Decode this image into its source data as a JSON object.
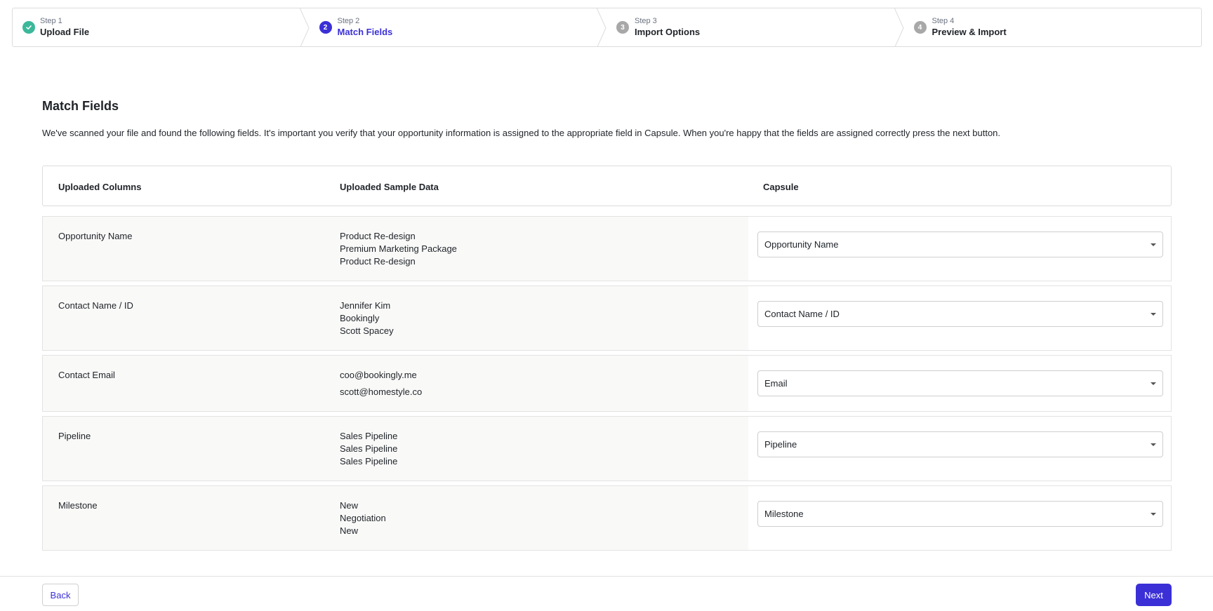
{
  "colors": {
    "accent": "#3b30d6",
    "complete": "#3bb89a",
    "pending": "#a8a8a8"
  },
  "steps": [
    {
      "number": "Step 1",
      "title": "Upload File",
      "badge": "check-icon",
      "state": "complete"
    },
    {
      "number": "Step 2",
      "title": "Match Fields",
      "badge": "2",
      "state": "current"
    },
    {
      "number": "Step 3",
      "title": "Import Options",
      "badge": "3",
      "state": "pending"
    },
    {
      "number": "Step 4",
      "title": "Preview & Import",
      "badge": "4",
      "state": "pending"
    }
  ],
  "page": {
    "title": "Match Fields",
    "description": "We've scanned your file and found the following fields. It's important you verify that your opportunity information is assigned to the appropriate field in Capsule. When you're happy that the fields are assigned correctly press the next button."
  },
  "table": {
    "headers": {
      "columns": "Uploaded Columns",
      "sample": "Uploaded Sample Data",
      "capsule": "Capsule"
    },
    "rows": [
      {
        "column": "Opportunity Name",
        "sample": [
          "Product Re-design",
          "Premium Marketing Package",
          "Product Re-design"
        ],
        "selected": "Opportunity Name"
      },
      {
        "column": "Contact Name / ID",
        "sample": [
          "Jennifer Kim",
          "Bookingly",
          "Scott Spacey"
        ],
        "selected": "Contact Name / ID"
      },
      {
        "column": "Contact Email",
        "sample": [
          "coo@bookingly.me",
          "scott@homestyle.co"
        ],
        "selected": "Email"
      },
      {
        "column": "Pipeline",
        "sample": [
          "Sales Pipeline",
          "Sales Pipeline",
          "Sales Pipeline"
        ],
        "selected": "Pipeline"
      },
      {
        "column": "Milestone",
        "sample": [
          "New",
          "Negotiation",
          "New"
        ],
        "selected": "Milestone"
      }
    ]
  },
  "footer": {
    "back_label": "Back",
    "next_label": "Next"
  }
}
